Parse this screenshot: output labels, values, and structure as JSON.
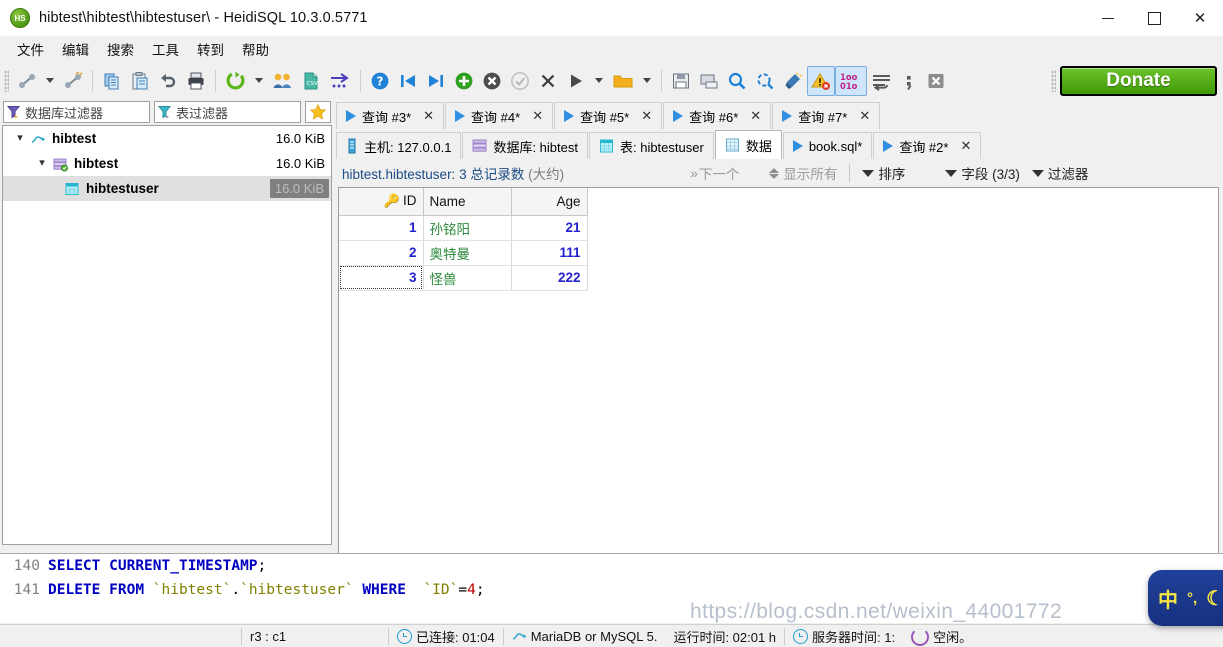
{
  "window": {
    "title": "hibtest\\hibtest\\hibtestuser\\ - HeidiSQL 10.3.0.5771",
    "logo_text": "HS",
    "minimize_label": "—",
    "maximize_label": "□",
    "close_label": "✕"
  },
  "menubar": {
    "items": [
      {
        "label": "文件",
        "name": "menu-file"
      },
      {
        "label": "编辑",
        "name": "menu-edit"
      },
      {
        "label": "搜索",
        "name": "menu-search"
      },
      {
        "label": "工具",
        "name": "menu-tools"
      },
      {
        "label": "转到",
        "name": "menu-goto"
      },
      {
        "label": "帮助",
        "name": "menu-help"
      }
    ]
  },
  "toolbar": {
    "donate_label": "Donate",
    "icons": [
      "session-manager-icon",
      "session-dropdown-icon",
      "disconnect-icon",
      "copy-icon",
      "paste-icon",
      "undo-icon",
      "print-icon",
      "refresh-icon",
      "refresh-dropdown-icon",
      "users-icon",
      "export-csv-icon",
      "import-icon",
      "help-icon",
      "first-icon",
      "last-icon",
      "add-icon",
      "delete-icon",
      "commit-icon",
      "rollback-icon",
      "run-icon",
      "run-dropdown-icon",
      "open-folder-icon",
      "open-dropdown-icon",
      "save-icon",
      "save-as-icon",
      "find-icon",
      "replace-icon",
      "clean-icon",
      "warning-icon",
      "binary-icon",
      "wordwrap-icon",
      "semicolon-icon",
      "stop-icon"
    ]
  },
  "sidebar": {
    "database_filter_placeholder": "数据库过滤器",
    "table_filter_placeholder": "表过滤器",
    "favorite_icon": "star-icon",
    "tree": [
      {
        "label": "hibtest",
        "size": "16.0 KiB",
        "icon": "connection-icon",
        "level": 0,
        "expanded": true,
        "selected": false
      },
      {
        "label": "hibtest",
        "size": "16.0 KiB",
        "icon": "database-icon",
        "level": 1,
        "expanded": true,
        "selected": false
      },
      {
        "label": "hibtestuser",
        "size": "16.0 KiB",
        "icon": "table-icon",
        "level": 2,
        "expanded": false,
        "selected": true
      }
    ]
  },
  "tabs_top": [
    {
      "label": "查询 #3*",
      "close": "✕",
      "active": false
    },
    {
      "label": "查询 #4*",
      "close": "✕",
      "active": false
    },
    {
      "label": "查询 #5*",
      "close": "✕",
      "active": false
    },
    {
      "label": "查询 #6*",
      "close": "✕",
      "active": false
    },
    {
      "label": "查询 #7*",
      "close": "✕",
      "active": false
    }
  ],
  "tabs_main": [
    {
      "label": "主机: 127.0.0.1",
      "icon": "host-icon",
      "active": false,
      "close": ""
    },
    {
      "label": "数据库: hibtest",
      "icon": "database-icon",
      "active": false,
      "close": ""
    },
    {
      "label": "表: hibtestuser",
      "icon": "table-icon",
      "active": false,
      "close": ""
    },
    {
      "label": "数据",
      "icon": "data-grid-icon",
      "active": true,
      "close": ""
    },
    {
      "label": "book.sql*",
      "icon": "query-icon",
      "active": false,
      "close": ""
    },
    {
      "label": "查询 #2*",
      "icon": "query-icon",
      "active": false,
      "close": "✕"
    }
  ],
  "data_toolbar": {
    "title_main": "hibtest.hibtestuser: 3 总记录数 ",
    "title_muted": "(大约)",
    "next_label": "下一个",
    "show_all_label": "显示所有",
    "sort_label": "排序",
    "columns_label": "字段 (3/3)",
    "filter_label": "过滤器"
  },
  "grid": {
    "columns": [
      {
        "label": "ID",
        "key": true,
        "align": "right"
      },
      {
        "label": "Name",
        "key": false,
        "align": "left"
      },
      {
        "label": "Age",
        "key": false,
        "align": "right"
      }
    ],
    "rows": [
      {
        "id": "1",
        "name": "孙铭阳",
        "age": "21",
        "focused": false
      },
      {
        "id": "2",
        "name": "奥特曼",
        "age": "111",
        "focused": false
      },
      {
        "id": "3",
        "name": "怪兽",
        "age": "222",
        "focused": true
      }
    ]
  },
  "sql_log": {
    "lines": [
      {
        "number": "140",
        "tokens": [
          {
            "t": "SELECT",
            "c": "kw"
          },
          {
            "t": " ",
            "c": "punct"
          },
          {
            "t": "CURRENT_TIMESTAMP",
            "c": "kw"
          },
          {
            "t": ";",
            "c": "punct"
          }
        ]
      },
      {
        "number": "141",
        "tokens": [
          {
            "t": "DELETE",
            "c": "kw"
          },
          {
            "t": " ",
            "c": "punct"
          },
          {
            "t": "FROM",
            "c": "kw"
          },
          {
            "t": " ",
            "c": "punct"
          },
          {
            "t": "`hibtest`",
            "c": "ident"
          },
          {
            "t": ".",
            "c": "punct"
          },
          {
            "t": "`hibtestuser`",
            "c": "ident"
          },
          {
            "t": " ",
            "c": "punct"
          },
          {
            "t": "WHERE",
            "c": "kw"
          },
          {
            "t": "  ",
            "c": "punct"
          },
          {
            "t": "`ID`",
            "c": "ident"
          },
          {
            "t": "=",
            "c": "punct"
          },
          {
            "t": "4",
            "c": "num"
          },
          {
            "t": ";",
            "c": "punct"
          }
        ]
      }
    ]
  },
  "statusbar": {
    "cursor": "r3 : c1",
    "connected": "已连接: 01:04",
    "server": "MariaDB or MySQL 5.",
    "uptime": "运行时间: 02:01 h",
    "server_time": "服务器时间: 1:",
    "idle": "空闲。"
  },
  "overlay": {
    "watermark": "https://blog.csdn.net/weixin_44001772",
    "ime_mode": "中",
    "ime_punct": "°,",
    "ime_moon": "☾"
  }
}
